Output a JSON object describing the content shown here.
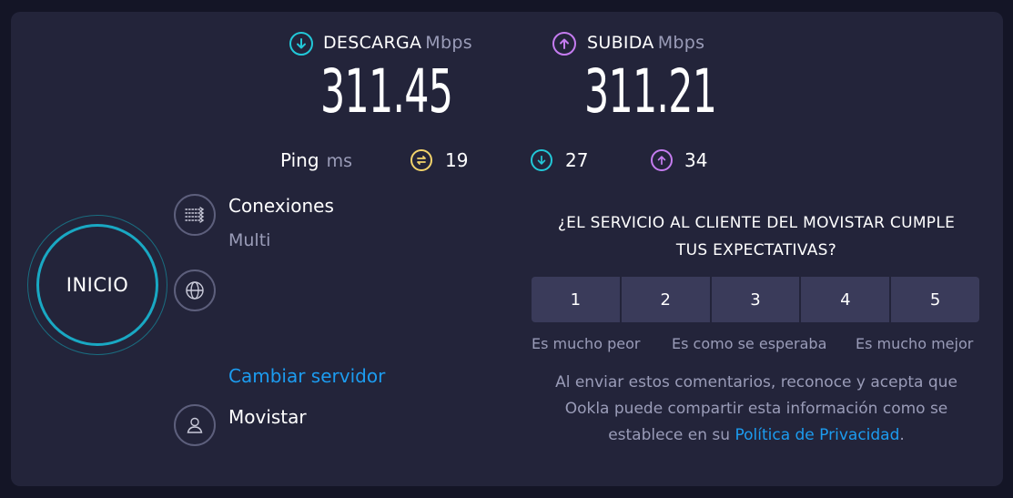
{
  "download": {
    "label": "DESCARGA",
    "unit": "Mbps",
    "value": "311.45",
    "icon": "arrow-down-circle-icon",
    "color": "#22c8d8"
  },
  "upload": {
    "label": "SUBIDA",
    "unit": "Mbps",
    "value": "311.21",
    "icon": "arrow-up-circle-icon",
    "color": "#c57cf0"
  },
  "ping": {
    "label": "Ping",
    "unit": "ms",
    "idle": "19",
    "download": "27",
    "upload": "34",
    "idle_color": "#f2d36b"
  },
  "connections": {
    "title": "Conexiones",
    "value": "Multi"
  },
  "server": {
    "change_label": "Cambiar servidor"
  },
  "provider": {
    "name": "Movistar"
  },
  "go_button": {
    "label": "INICIO",
    "color": "#19a8c3"
  },
  "survey": {
    "question_line1": "¿EL SERVICIO AL CLIENTE DEL MOVISTAR CUMPLE",
    "question_line2": "TUS EXPECTATIVAS?",
    "options": [
      "1",
      "2",
      "3",
      "4",
      "5"
    ],
    "scale_low": "Es mucho peor",
    "scale_mid": "Es como se esperaba",
    "scale_high": "Es mucho mejor",
    "disclaimer_line1": "Al enviar estos comentarios, reconoce y acepta que",
    "disclaimer_line2": "Ookla puede compartir esta información como se",
    "disclaimer_line3_pre": "establece en su ",
    "privacy_link": "Política de Privacidad",
    "disclaimer_line3_post": "."
  }
}
